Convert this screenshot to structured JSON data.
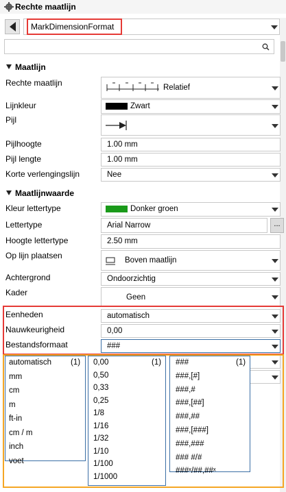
{
  "window": {
    "title": "Rechte maatlijn"
  },
  "toolbar": {
    "format_value": "MarkDimensionFormat",
    "search_placeholder": ""
  },
  "sections": {
    "maatlijn": "Maatlijn",
    "maatlijnwaarde": "Maatlijnwaarde"
  },
  "props": {
    "rechte_maatlijn": {
      "label": "Rechte maatlijn",
      "value": "Relatief"
    },
    "lijnkleur": {
      "label": "Lijnkleur",
      "value": "Zwart",
      "color": "#000000"
    },
    "pijl": {
      "label": "Pijl"
    },
    "pijlhoogte": {
      "label": "Pijlhoogte",
      "value": "1.00 mm"
    },
    "pijl_lengte": {
      "label": "Pijl lengte",
      "value": "1.00 mm"
    },
    "korte_verlengingslijn": {
      "label": "Korte verlengingslijn",
      "value": "Nee"
    },
    "kleur_lettertype": {
      "label": "Kleur lettertype",
      "value": "Donker groen",
      "color": "#1a9a1a"
    },
    "lettertype": {
      "label": "Lettertype",
      "value": "Arial Narrow",
      "button": "..."
    },
    "hoogte_lettertype": {
      "label": "Hoogte lettertype",
      "value": "2.50 mm"
    },
    "op_lijn_plaatsen": {
      "label": "Op lijn plaatsen",
      "value": "Boven maatlijn"
    },
    "achtergrond": {
      "label": "Achtergrond",
      "value": "Ondoorzichtig"
    },
    "kader": {
      "label": "Kader",
      "value": "Geen"
    },
    "eenheden": {
      "label": "Eenheden",
      "value": "automatisch"
    },
    "nauwkeurigheid": {
      "label": "Nauwkeurigheid",
      "value": "0,00"
    },
    "bestandsformaat": {
      "label": "Bestandsformaat",
      "value": "###"
    }
  },
  "dropdowns": {
    "units": {
      "badge": "(1)",
      "items": [
        "automatisch",
        "mm",
        "cm",
        "m",
        "ft-in",
        "cm / m",
        "inch",
        "voet"
      ]
    },
    "precision": {
      "badge": "(1)",
      "items": [
        "0,00",
        "0,50",
        "0,33",
        "0,25",
        "1/8",
        "1/16",
        "1/32",
        "1/10",
        "1/100",
        "1/1000"
      ]
    },
    "format": {
      "badge": "(1)",
      "items": [
        "###",
        "###,[#]",
        "###,#",
        "###,[##]",
        "###,##",
        "###,[###]",
        "###,###",
        "### #/#",
        "###ˣ/##,##ˣ"
      ]
    }
  },
  "colors": {
    "highlight_red": "#e53935",
    "highlight_orange": "#f5a623",
    "list_border": "#3a6ea5"
  }
}
